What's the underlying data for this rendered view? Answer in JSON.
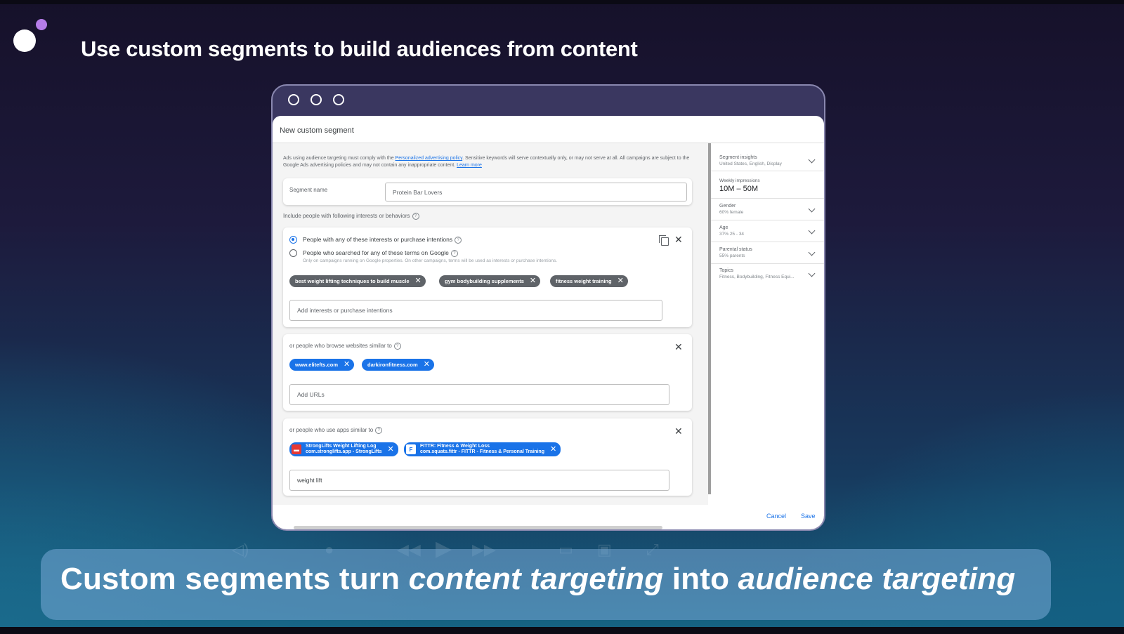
{
  "slide": {
    "title": "Use custom segments to build audiences from content",
    "caption": {
      "part1": "Custom segments turn ",
      "emph1": "content targeting",
      "part2": " into ",
      "emph2": "audience targeting"
    }
  },
  "dialog": {
    "title": "New custom segment",
    "policy": {
      "text1": "Ads using audience targeting must comply with the ",
      "policy_link": "Personalized advertising policy",
      "text2": ". Sensitive keywords will serve contextually only, or may not serve at all. All campaigns are subject to the Google Ads advertising policies and may not contain any inappropriate content. ",
      "learn_more": "Learn more"
    },
    "segment_name": {
      "label": "Segment name",
      "value": "Protein Bar Lovers"
    },
    "include_label": "Include people with following interests or behaviors",
    "interests": {
      "option1": "People with any of these interests or purchase intentions",
      "option2": "People who searched for any of these terms on Google",
      "option2_hint": "Only on campaigns running on Google properties. On other campaigns, terms will be used as interests or purchase intentions.",
      "selected": "option1",
      "chips": [
        "best weight lifting techniques to build muscle",
        "gym bodybuilding supplements",
        "fitness weight training"
      ],
      "placeholder": "Add interests or purchase intentions"
    },
    "websites": {
      "label": "or people who browse websites similar to",
      "chips": [
        "www.elitefts.com",
        "darkironfitness.com"
      ],
      "placeholder": "Add URLs"
    },
    "apps": {
      "label": "or people who use apps similar to",
      "chips": [
        {
          "line1": "StrongLifts Weight Lifting Log",
          "line2": "com.stronglifts.app - StrongLifts",
          "icon": "barbell-app-icon"
        },
        {
          "line1": "FITTR: Fitness & Weight Loss",
          "line2": "com.squats.fittr - FITTR - Fitness & Personal Training",
          "icon": "fittr-app-icon"
        }
      ],
      "value": "weight lift"
    },
    "insights": {
      "segment": {
        "title": "Segment insights",
        "value": "United States, English, Display"
      },
      "impressions": {
        "title": "Weekly impressions",
        "value": "10M – 50M"
      },
      "gender": {
        "title": "Gender",
        "value": "60% female"
      },
      "age": {
        "title": "Age",
        "value": "37% 25 - 34"
      },
      "parental": {
        "title": "Parental status",
        "value": "55% parents"
      },
      "topics": {
        "title": "Topics",
        "value": "Fitness, Bodybuilding, Fitness Equi..."
      }
    },
    "footer": {
      "cancel": "Cancel",
      "save": "Save"
    }
  },
  "colors": {
    "chip_gray": "#5f6368",
    "chip_blue": "#1a73e8",
    "accent_purple": "#b57ce8"
  }
}
